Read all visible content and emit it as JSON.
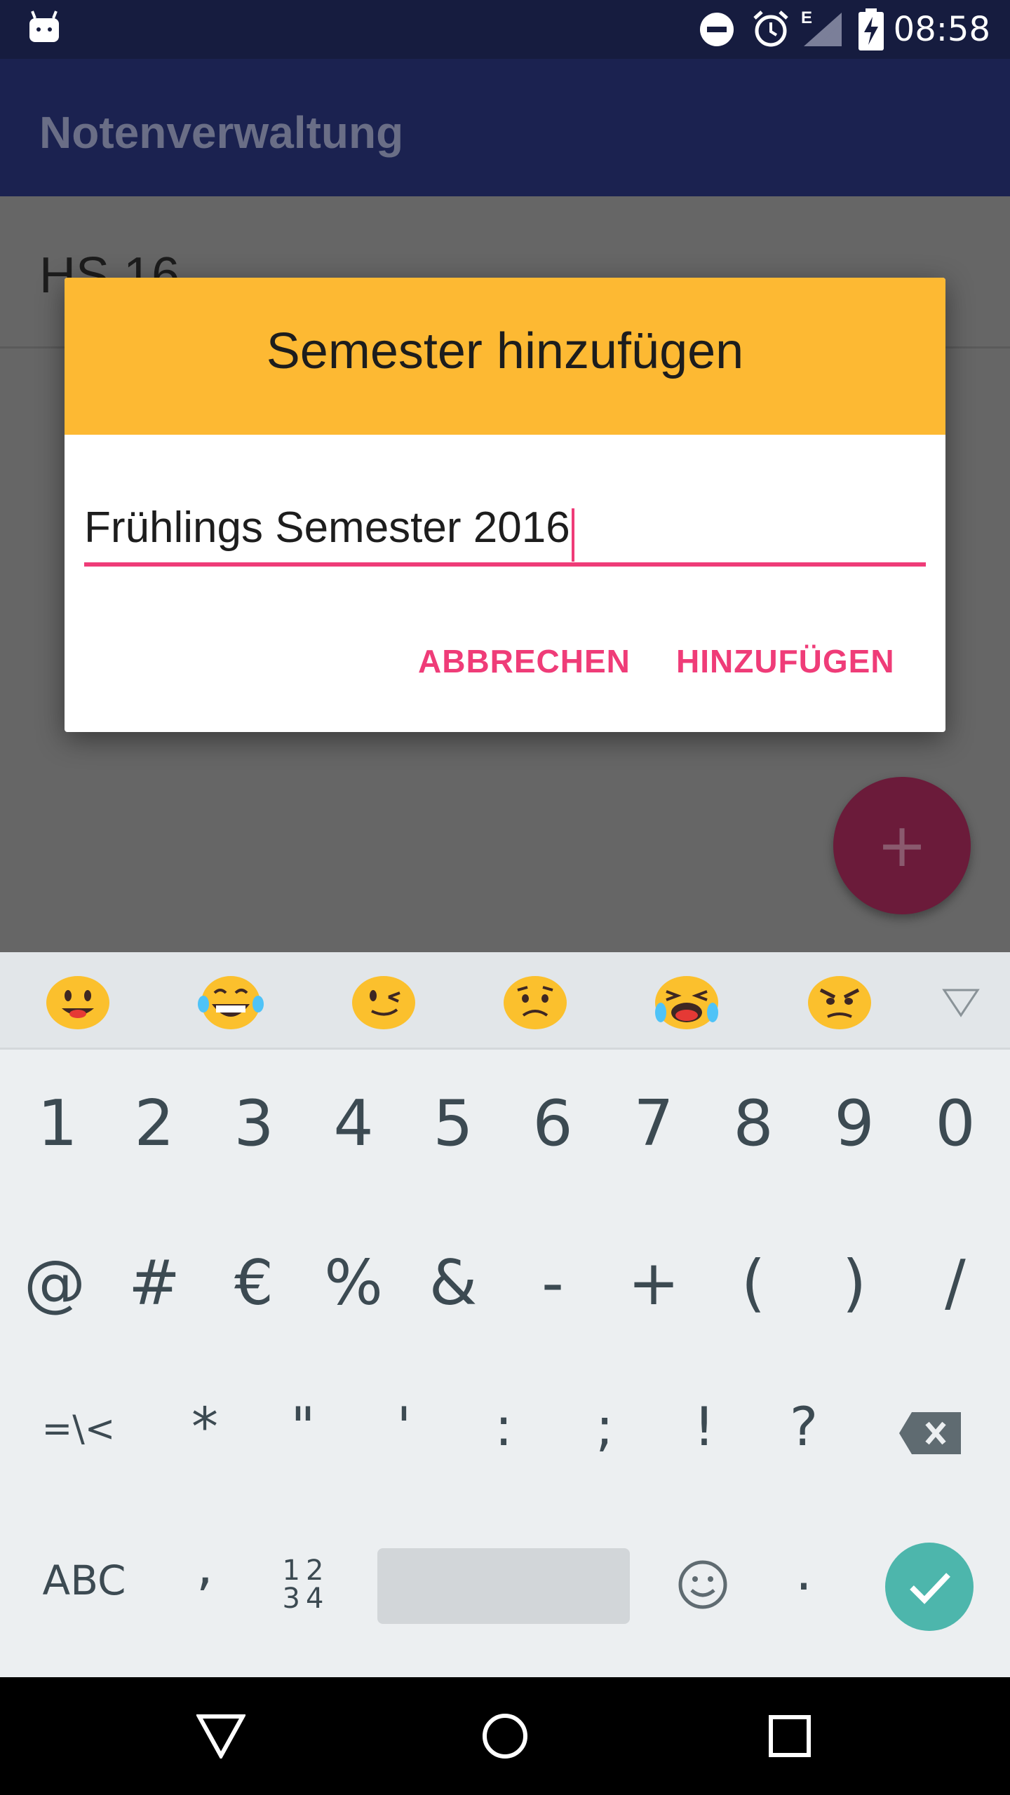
{
  "status_bar": {
    "time": "08:58",
    "network": "E",
    "icons": [
      "android-notification-icon",
      "do-not-disturb-icon",
      "alarm-icon",
      "signal-icon",
      "battery-charging-icon"
    ]
  },
  "app_bar": {
    "title": "Notenverwaltung"
  },
  "list": {
    "items": [
      {
        "label": "HS 16"
      }
    ]
  },
  "fab": {
    "label": "+"
  },
  "dialog": {
    "title": "Semester hinzufügen",
    "input_value": "Frühlings Semester 2016",
    "cancel_label": "ABBRECHEN",
    "confirm_label": "HINZUFÜGEN",
    "accent_color": "#ef3c78",
    "header_color": "#fdb933"
  },
  "keyboard": {
    "emoji_suggestions": [
      "smiley-icon",
      "tears-of-joy-icon",
      "wink-icon",
      "frown-icon",
      "crying-icon",
      "angry-icon"
    ],
    "row1": [
      "1",
      "2",
      "3",
      "4",
      "5",
      "6",
      "7",
      "8",
      "9",
      "0"
    ],
    "row2": [
      "@",
      "#",
      "€",
      "%",
      "&",
      "-",
      "+",
      "(",
      ")",
      "/"
    ],
    "row3": [
      "=\\<",
      "*",
      "\"",
      "'",
      ":",
      ";",
      "!",
      "?"
    ],
    "bottom": {
      "abc": "ABC",
      "comma": ",",
      "numpad_top": "12",
      "numpad_bottom": "34",
      "period": "."
    },
    "enter_color": "#4db6ac"
  },
  "nav_bar": {
    "icons": [
      "back-icon",
      "home-icon",
      "recents-icon"
    ]
  }
}
